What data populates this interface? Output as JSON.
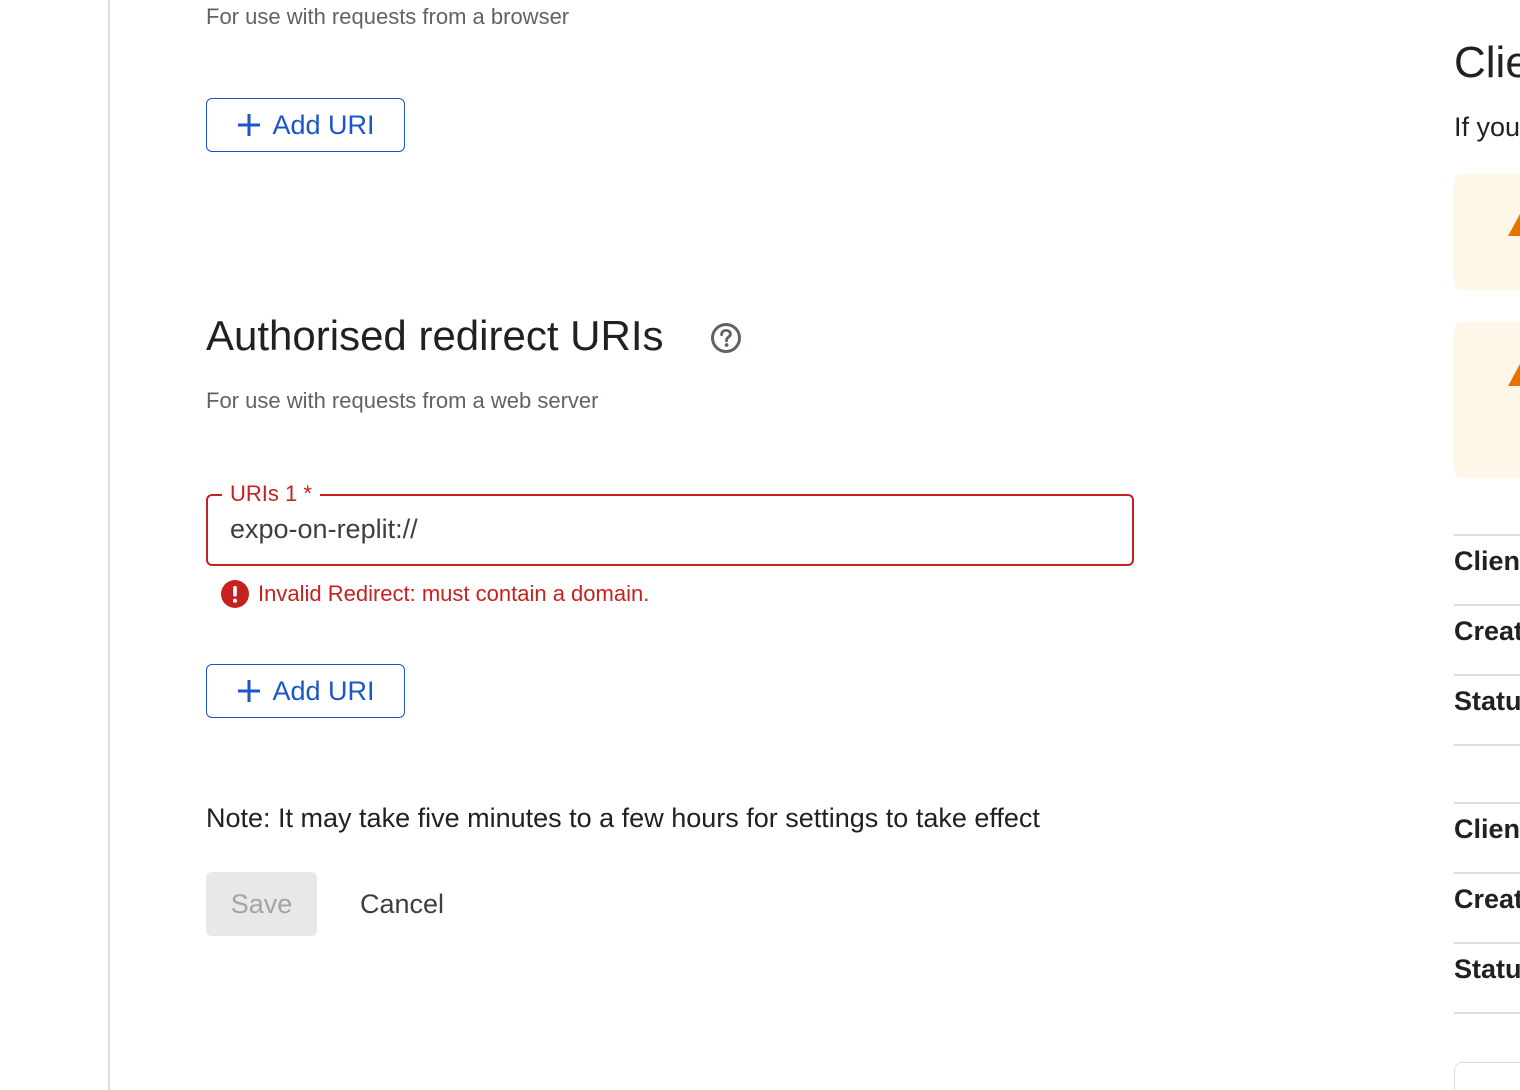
{
  "origins_section": {
    "description": "For use with requests from a browser",
    "add_button_label": "Add URI"
  },
  "redirect_section": {
    "title": "Authorised redirect URIs",
    "description": "For use with requests from a web server",
    "field": {
      "label": "URIs 1 *",
      "value": "expo-on-replit://"
    },
    "error_message": "Invalid Redirect: must contain a domain.",
    "add_button_label": "Add URI"
  },
  "note": "Note: It may take five minutes to a few hours for settings to take effect",
  "actions": {
    "save_label": "Save",
    "cancel_label": "Cancel"
  },
  "right_panel": {
    "title": "Clie",
    "intro": "If you",
    "rows": [
      "Clien",
      "Creat",
      "Statu",
      "Clien",
      "Creat",
      "Statu"
    ]
  },
  "colors": {
    "primary": "#1a56c8",
    "error": "#c5221f",
    "warning": "#e37400",
    "warning_bg": "#fef7e8"
  },
  "icons": {
    "add": "plus-icon",
    "help": "help-circle-icon",
    "error": "error-circle-icon",
    "warning": "warning-triangle-icon"
  }
}
